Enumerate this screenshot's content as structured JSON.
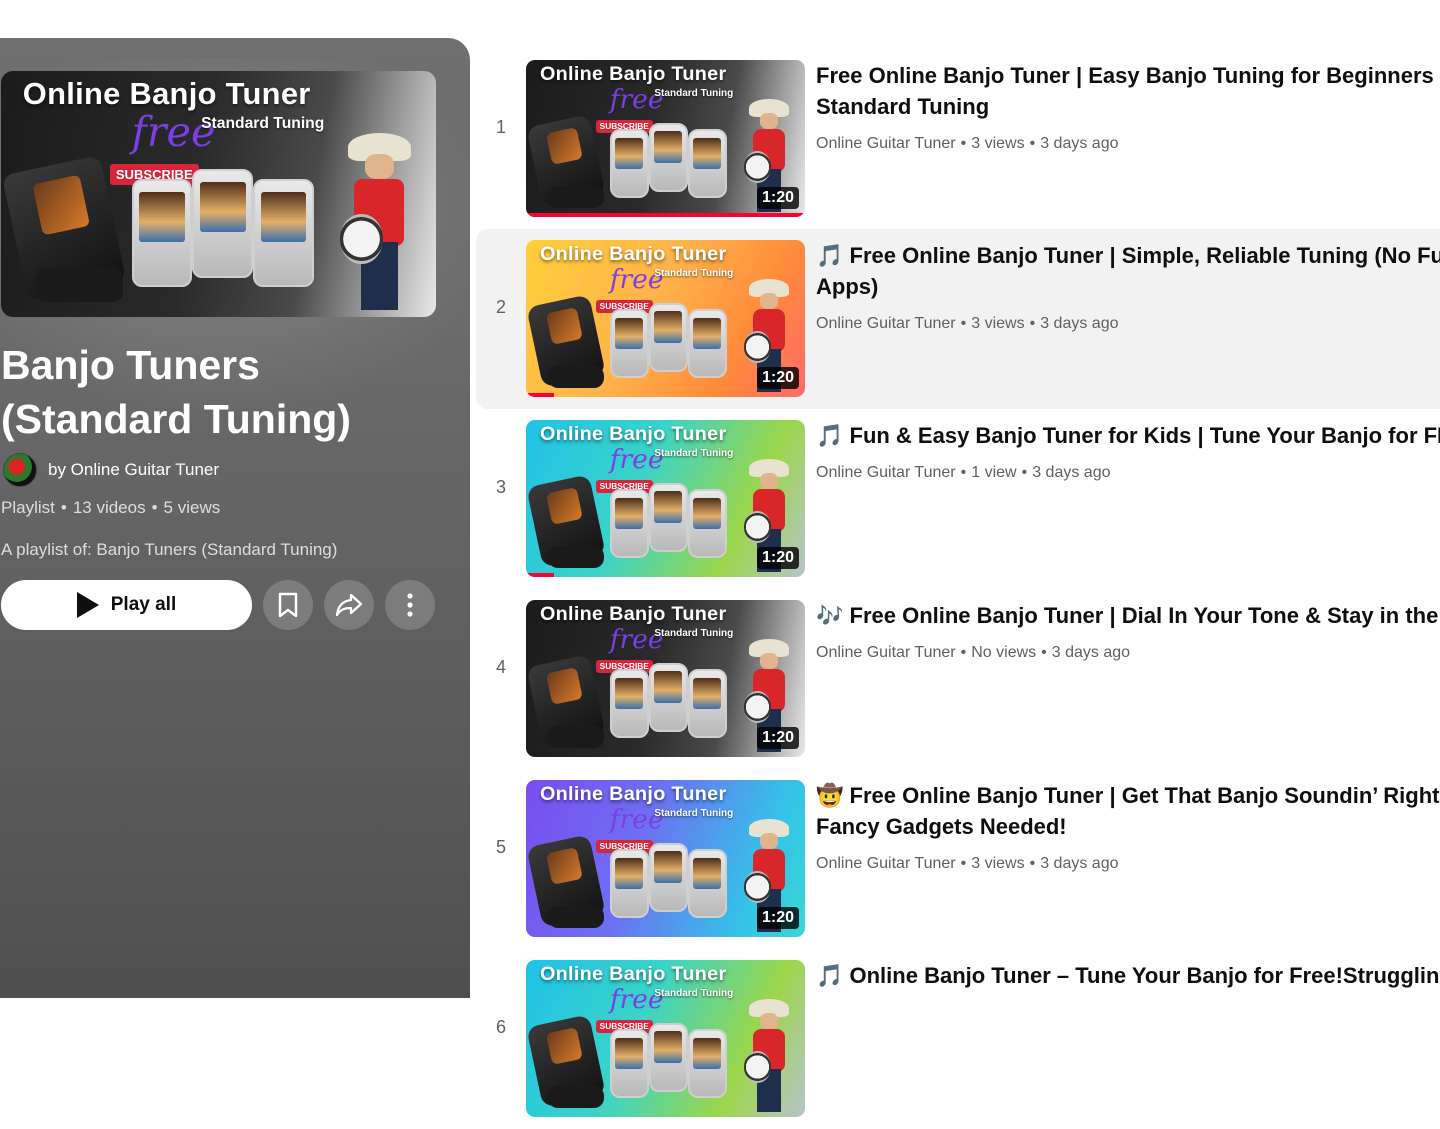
{
  "playlist": {
    "title": "Banjo Tuners (Standard Tuning)",
    "owner": "by Online Guitar Tuner",
    "type": "Playlist",
    "video_count": "13 videos",
    "views": "5 views",
    "description": "A playlist of: Banjo Tuners (Standard Tuning)",
    "play_all_label": "Play all",
    "icons": {
      "save": "bookmark-icon",
      "share": "share-icon",
      "more": "more-vert-icon"
    }
  },
  "thumbnail_text": {
    "title": "Online Banjo Tuner",
    "subtitle": "Standard Tuning",
    "free": "free",
    "subscribe": "SUBSCRIBE"
  },
  "videos": [
    {
      "index": "1",
      "title_line1": "Free Online Banjo Tuner | Easy Banjo Tuning for Beginners 🎵",
      "title_line2": "Standard Tuning",
      "channel": "Online Guitar Tuner",
      "views": "3 views",
      "age": "3 days ago",
      "duration": "1:20",
      "watched_fraction": 1.0,
      "theme": "dark"
    },
    {
      "index": "2",
      "title_line1": "🎵 Free Online Banjo Tuner | Simple, Reliable Tuning (No Fuss,",
      "title_line2": "Apps)",
      "channel": "Online Guitar Tuner",
      "views": "3 views",
      "age": "3 days ago",
      "duration": "1:20",
      "watched_fraction": 0.1,
      "theme": "sunset"
    },
    {
      "index": "3",
      "title_line1": "🎵 Fun & Easy Banjo Tuner for Kids | Tune Your Banjo for FREE",
      "title_line2": "",
      "channel": "Online Guitar Tuner",
      "views": "1 view",
      "age": "3 days ago",
      "duration": "1:20",
      "watched_fraction": 0.1,
      "theme": "aqua"
    },
    {
      "index": "4",
      "title_line1": "🎶 Free Online Banjo Tuner | Dial In Your Tone & Stay in the Gro",
      "title_line2": "",
      "channel": "Online Guitar Tuner",
      "views": "No views",
      "age": "3 days ago",
      "duration": "1:20",
      "watched_fraction": 0,
      "theme": "dark"
    },
    {
      "index": "5",
      "title_line1": "🤠 Free Online Banjo Tuner | Get That Banjo Soundin’ Right. No",
      "title_line2": "Fancy Gadgets Needed!",
      "channel": "Online Guitar Tuner",
      "views": "3 views",
      "age": "3 days ago",
      "duration": "1:20",
      "watched_fraction": 0,
      "theme": "violet"
    },
    {
      "index": "6",
      "title_line1": "🎵 Online Banjo Tuner – Tune Your Banjo for Free!Struggling to",
      "title_line2": "",
      "channel": "",
      "views": "",
      "age": "",
      "duration": "",
      "watched_fraction": 0,
      "theme": "aqua"
    }
  ],
  "colors": {
    "progress": "#ff0033",
    "free_text": "#7b3fe4",
    "subscribe_badge": "#d8253a"
  }
}
